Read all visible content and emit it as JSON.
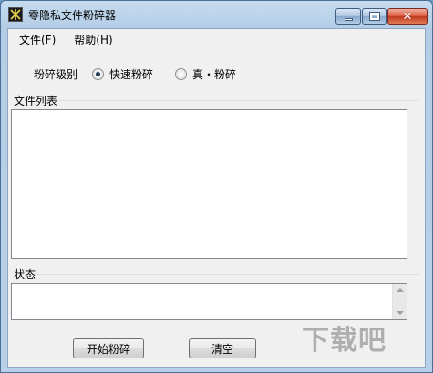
{
  "window": {
    "title": "零隐私文件粉碎器",
    "controls": {
      "minimize": "",
      "maximize": "",
      "close": "✕"
    }
  },
  "menu": [
    {
      "label": "文件(F)"
    },
    {
      "label": "帮助(H)"
    }
  ],
  "level": {
    "label": "粉碎级别",
    "options": [
      {
        "label": "快速粉碎",
        "selected": true
      },
      {
        "label": "真・粉碎",
        "selected": false
      }
    ]
  },
  "file_list": {
    "label": "文件列表"
  },
  "status": {
    "label": "状态"
  },
  "buttons": {
    "start": "开始粉碎",
    "clear": "清空"
  },
  "watermark": "下载吧"
}
